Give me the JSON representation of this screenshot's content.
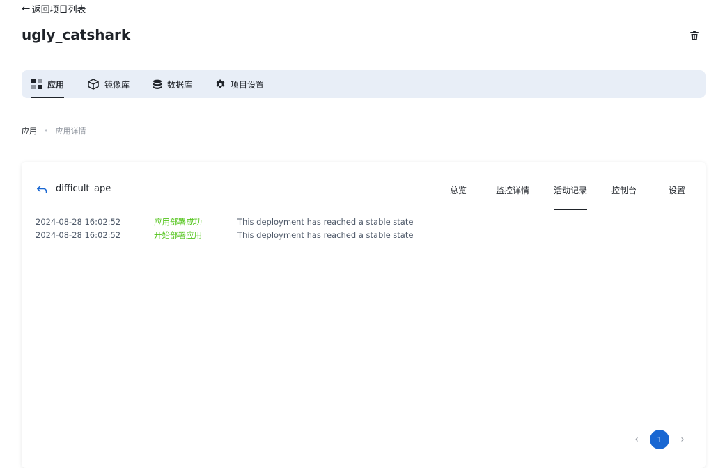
{
  "back": {
    "label": "返回项目列表"
  },
  "project": {
    "title": "ugly_catshark"
  },
  "tabs": [
    {
      "label": "应用",
      "icon": "grid-icon"
    },
    {
      "label": "镜像库",
      "icon": "cube-icon"
    },
    {
      "label": "数据库",
      "icon": "database-icon"
    },
    {
      "label": "项目设置",
      "icon": "gear-icon"
    }
  ],
  "active_tab": "应用",
  "breadcrumb": {
    "root": "应用",
    "separator": "•",
    "current": "应用详情"
  },
  "app": {
    "name": "difficult_ape",
    "subtabs": [
      "总览",
      "监控详情",
      "活动记录",
      "控制台",
      "设置"
    ],
    "active_subtab": "活动记录"
  },
  "logs": [
    {
      "time": "2024-08-28 16:02:52",
      "status": "应用部署成功",
      "message": "This deployment has reached a stable state"
    },
    {
      "time": "2024-08-28 16:02:52",
      "status": "开始部署应用",
      "message": "This deployment has reached a stable state"
    }
  ],
  "pagination": {
    "prev": "‹",
    "current_page": "1",
    "next": "›"
  },
  "colors": {
    "accent": "#1967d2",
    "success": "#52c41a",
    "tabbar_bg": "#e8eef7"
  }
}
